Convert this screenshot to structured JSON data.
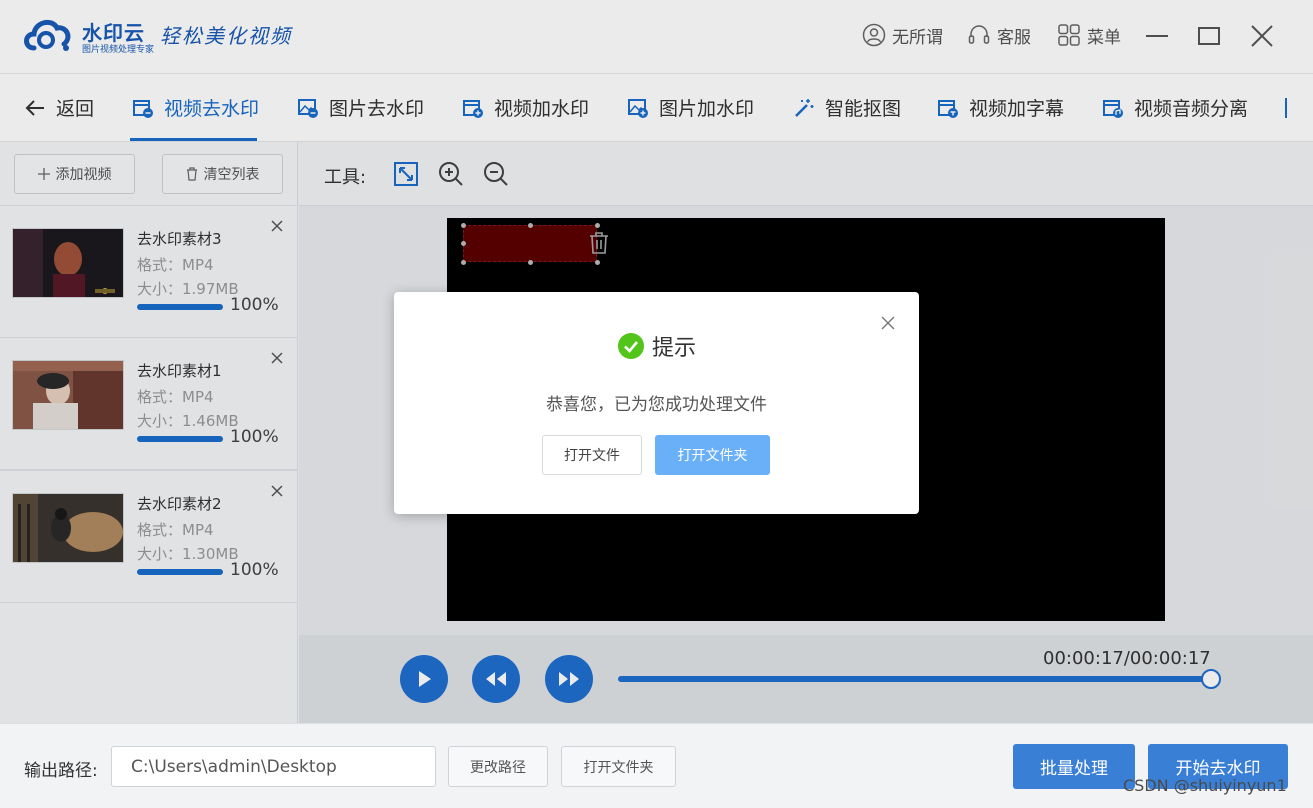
{
  "app": {
    "brand": "水印云",
    "brand_sub": "图片视频处理专家",
    "slogan": "轻松美化视频"
  },
  "titlebar": {
    "user": "无所谓",
    "service": "客服",
    "menu": "菜单"
  },
  "tabs": {
    "back": "返回",
    "items": [
      {
        "label": "视频去水印",
        "icon": "video-remove-icon",
        "active": true
      },
      {
        "label": "图片去水印",
        "icon": "image-remove-icon"
      },
      {
        "label": "视频加水印",
        "icon": "video-add-icon"
      },
      {
        "label": "图片加水印",
        "icon": "image-add-icon"
      },
      {
        "label": "智能抠图",
        "icon": "magic-wand-icon"
      },
      {
        "label": "视频加字幕",
        "icon": "video-subtitle-icon"
      },
      {
        "label": "视频音频分离",
        "icon": "video-audio-split-icon"
      }
    ]
  },
  "sidebar": {
    "add_video": "添加视频",
    "clear_list": "清空列表",
    "files": [
      {
        "name": "去水印素材3",
        "format": "格式：MP4",
        "size": "大小：1.97MB",
        "percent": "100%",
        "progress": 1.0
      },
      {
        "name": "去水印素材1",
        "format": "格式：MP4",
        "size": "大小：1.46MB",
        "percent": "100%",
        "progress": 1.0
      },
      {
        "name": "去水印素材2",
        "format": "格式：MP4",
        "size": "大小：1.30MB",
        "percent": "100%",
        "progress": 1.0
      }
    ]
  },
  "toolbar": {
    "label": "工具:"
  },
  "player": {
    "timecode": "00:00:17/00:00:17",
    "progress": 1.0
  },
  "dialog": {
    "title": "提示",
    "message": "恭喜您，已为您成功处理文件",
    "open_file": "打开文件",
    "open_folder": "打开文件夹"
  },
  "bottom": {
    "output_label": "输出路径:",
    "output_path": "C:\\Users\\admin\\Desktop",
    "change_path": "更改路径",
    "open_folder": "打开文件夹",
    "batch": "批量处理",
    "start": "开始去水印",
    "watermark": "CSDN @shuiyinyun1"
  },
  "colors": {
    "accent": "#1a6dcc",
    "primary_button": "#3a7fd6",
    "dialog_primary": "#6ab0f8",
    "success": "#52c41a"
  }
}
